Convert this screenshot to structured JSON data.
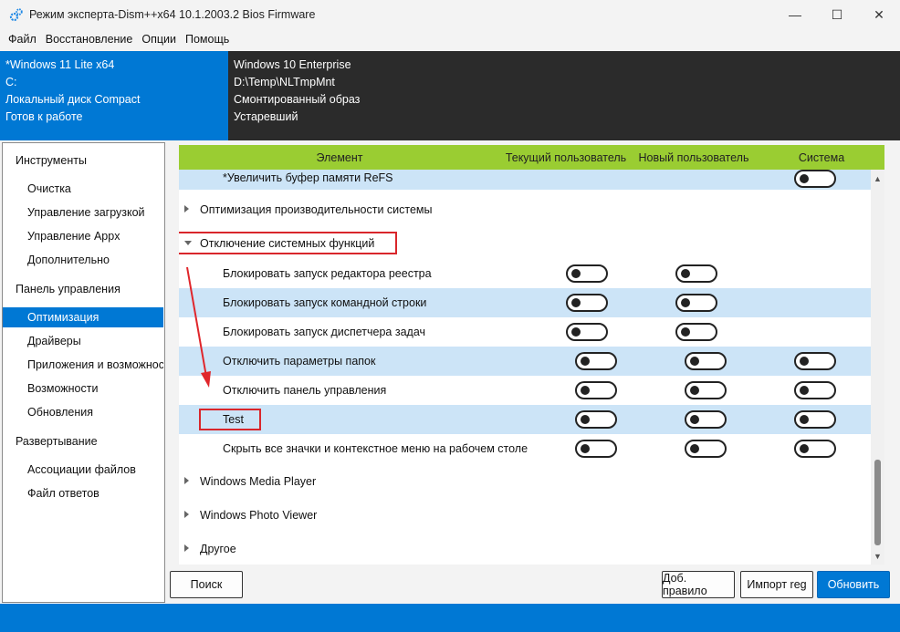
{
  "window": {
    "title": "Режим эксперта-Dism++x64 10.1.2003.2 Bios Firmware",
    "minimize_glyph": "—",
    "maximize_glyph": "☐",
    "close_glyph": "✕"
  },
  "menu": [
    "Файл",
    "Восстановление",
    "Опции",
    "Помощь"
  ],
  "info_left": [
    "*Windows 11 Lite x64",
    "C:",
    "Локальный диск Compact",
    "Готов к работе"
  ],
  "info_right": [
    "Windows 10 Enterprise",
    "D:\\Temp\\NLTmpMnt",
    "Смонтированный образ",
    "Устаревший"
  ],
  "sidebar": {
    "sections": [
      "Инструменты",
      "Панель управления",
      "Развертывание"
    ],
    "items": [
      "Очистка",
      "Управление загрузкой",
      "Управление Appx",
      "Дополнительно",
      "Оптимизация",
      "Драйверы",
      "Приложения и возможнос",
      "Возможности",
      "Обновления",
      "Ассоциации файлов",
      "Файл ответов"
    ],
    "active_item": "Оптимизация"
  },
  "table": {
    "headers": [
      "Элемент",
      "Текущий пользователь",
      "Новый пользователь",
      "Система"
    ],
    "rows": [
      {
        "label": "*Увеличить буфер памяти ReFS",
        "kind": "item",
        "toggles": [
          false,
          false,
          true
        ]
      },
      {
        "label": "Оптимизация производительности системы",
        "kind": "group",
        "expanded": false
      },
      {
        "label": "Отключение системных функций",
        "kind": "group",
        "expanded": true
      },
      {
        "label": "Блокировать запуск редактора реестра",
        "kind": "item",
        "toggles": [
          true,
          true,
          false
        ]
      },
      {
        "label": "Блокировать запуск командной строки",
        "kind": "item",
        "toggles": [
          true,
          true,
          false
        ]
      },
      {
        "label": "Блокировать запуск диспетчера задач",
        "kind": "item",
        "toggles": [
          true,
          true,
          false
        ]
      },
      {
        "label": "Отключить параметры папок",
        "kind": "item",
        "toggles": [
          true,
          true,
          true
        ]
      },
      {
        "label": "Отключить панель управления",
        "kind": "item",
        "toggles": [
          true,
          true,
          true
        ]
      },
      {
        "label": "Test",
        "kind": "item",
        "toggles": [
          true,
          true,
          true
        ]
      },
      {
        "label": "Скрыть все значки и контекстное меню на рабочем столе",
        "kind": "item",
        "toggles": [
          true,
          true,
          true
        ]
      },
      {
        "label": "Windows Media Player",
        "kind": "group",
        "expanded": false
      },
      {
        "label": "Windows Photo Viewer",
        "kind": "group",
        "expanded": false
      },
      {
        "label": "Другое",
        "kind": "group",
        "expanded": false
      }
    ],
    "toggle_states": "all toggles shown in off state"
  },
  "buttons": {
    "search": "Поиск",
    "add_rule": "Доб. правило",
    "import_reg": "Импорт reg",
    "refresh": "Обновить"
  },
  "colors": {
    "accent": "#0078d4",
    "header_green": "#9acd32",
    "row_highlight": "#cce4f7",
    "annotation_red": "#d9262b",
    "info_dark": "#2b2b2b"
  }
}
